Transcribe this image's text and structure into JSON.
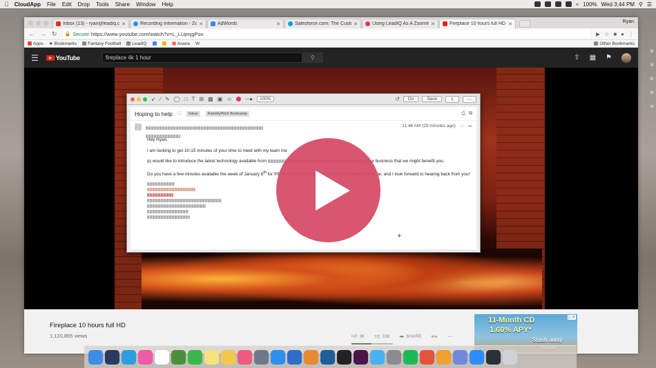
{
  "menubar": {
    "app": "CloudApp",
    "items": [
      "File",
      "Edit",
      "Drop",
      "Tools",
      "Share",
      "Window",
      "Help"
    ],
    "battery": "100%",
    "clock": "Wed 3:44 PM"
  },
  "browser": {
    "tabs": [
      {
        "label": "Inbox (13) - ryan@leadiq.com",
        "color": "#d93025",
        "icon": "gmail-icon"
      },
      {
        "label": "Recording Information - Zoom",
        "color": "#2d8cff",
        "icon": "zoom-icon"
      },
      {
        "label": "AdWords",
        "color": "#4285f4",
        "icon": "adwords-icon"
      },
      {
        "label": "Salesforce.com: The Customer",
        "color": "#00a1e0",
        "icon": "salesforce-icon"
      },
      {
        "label": "Using LeadIQ As A ZoomInfo A",
        "color": "#e0335a",
        "icon": "leadiq-icon"
      },
      {
        "label": "Fireplace 10 hours full HD",
        "color": "#e62117",
        "icon": "youtube-icon"
      }
    ],
    "profile": "Ryan",
    "url_secure": "Secure",
    "url": "https://www.youtube.com/watch?v=L_LUpnjgPso",
    "bookmarks": [
      "Apps",
      "Bookmarks",
      "Fantasy Football",
      "LeadIQ",
      "Asana"
    ],
    "other_bookmarks": "Other Bookmarks"
  },
  "youtube": {
    "logo": "YouTube",
    "search_value": "fireplace 4k 1 hour",
    "video_title": "Fireplace 10 hours full HD",
    "views": "1,120,855 views",
    "likes": "3K",
    "dislikes": "336",
    "share": "SHARE",
    "like_ratio": 0.48
  },
  "snap": {
    "zoom": "100%",
    "do_label": "Do",
    "save_label": "Save",
    "subject": "Hoping to help",
    "labels": [
      "Inbox",
      "RateMyPitch Bootcamp"
    ],
    "timestamp": "11:46 AM (29 minutes ago)",
    "greeting": "Hey Ryan,",
    "line1": "I am looking to get 10-15 minutes of your time to meet with my team me",
    "line2a": "would like to introduce the latest technology available from",
    "line2b": "your business that we might benefit you.",
    "line3a": "Do you have a few minutes available the week of January 8",
    "line3sup": "th",
    "line3b": "for",
    "line3c": "season thus far, and I look forward to hearing back from you!"
  },
  "ad": {
    "line1": "11-Month CD",
    "line2": "1.60% APY*",
    "line3": "Stash away",
    "line4": "some"
  },
  "dock": {
    "apps": [
      {
        "name": "finder-icon",
        "color": "#3d8ee8"
      },
      {
        "name": "launchpad-icon",
        "color": "#2a3a63"
      },
      {
        "name": "safari-icon",
        "color": "#2f9de0"
      },
      {
        "name": "itunes-icon",
        "color": "#ef5aa8"
      },
      {
        "name": "calendar-icon",
        "color": "#ffffff"
      },
      {
        "name": "xcode-icon",
        "color": "#4a8f3c"
      },
      {
        "name": "facetime-icon",
        "color": "#3ab74d"
      },
      {
        "name": "notes-icon",
        "color": "#f6e27a"
      },
      {
        "name": "photos-icon",
        "color": "#f3c84a"
      },
      {
        "name": "music-icon",
        "color": "#f05a7e"
      },
      {
        "name": "rocket-icon",
        "color": "#6d7a8a"
      },
      {
        "name": "appstore-icon",
        "color": "#2f8ef0"
      },
      {
        "name": "keynote-icon",
        "color": "#2f6ec8"
      },
      {
        "name": "books-icon",
        "color": "#e98a2e"
      },
      {
        "name": "quicktime-icon",
        "color": "#1c5e9a"
      },
      {
        "name": "terminal-icon",
        "color": "#222222"
      },
      {
        "name": "slack-icon",
        "color": "#4a154b"
      },
      {
        "name": "messages-icon",
        "color": "#4ab1f0"
      },
      {
        "name": "preferences-icon",
        "color": "#8a8d90"
      },
      {
        "name": "spotify-icon",
        "color": "#1db954"
      },
      {
        "name": "chrome-icon",
        "color": "#e5533d"
      },
      {
        "name": "sketch-icon",
        "color": "#f0a22e"
      },
      {
        "name": "discord-icon",
        "color": "#7289da"
      },
      {
        "name": "zoom-dock-icon",
        "color": "#2d8cff"
      },
      {
        "name": "cloudapp-icon",
        "color": "#2b2f36"
      },
      {
        "name": "trash-icon",
        "color": "#cfd3d6"
      }
    ]
  }
}
